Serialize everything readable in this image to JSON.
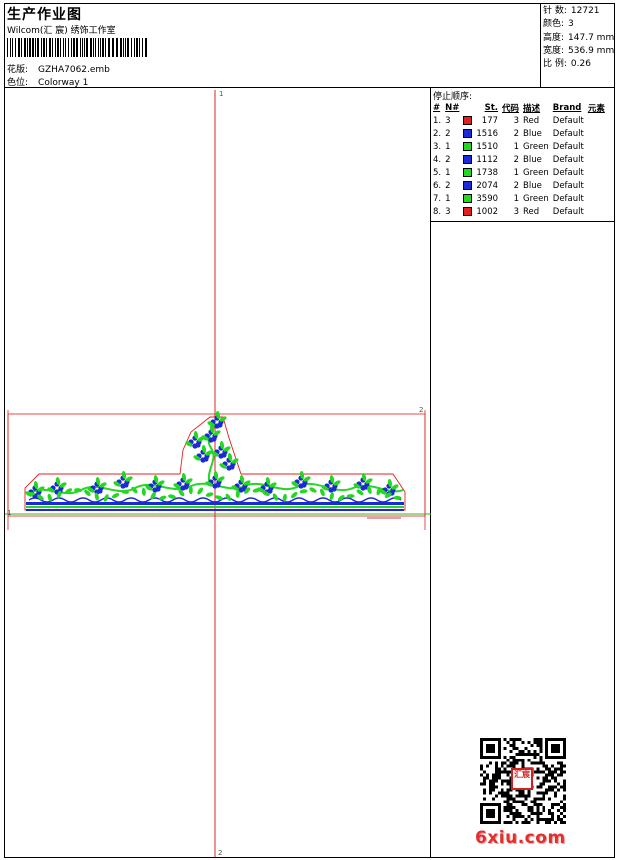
{
  "header": {
    "title": "生产作业图",
    "company": "Wilcom(汇 宸) 绣饰工作室",
    "design_label": "花版:",
    "design_value": "GZHA7062.emb",
    "colorway_label": "色位:",
    "colorway_value": "Colorway 1"
  },
  "stats": {
    "stitches_label": "针 数:",
    "stitches_value": "12721",
    "colors_label": "颜色:",
    "colors_value": "3",
    "height_label": "高度:",
    "height_value": "147.7 mm",
    "width_label": "宽度:",
    "width_value": "536.9 mm",
    "scale_label": "比 例:",
    "scale_value": "0.26"
  },
  "stop_sequence": {
    "title": "停止顺序:",
    "headers": [
      "#",
      "N#",
      "St.",
      "代码",
      "描述",
      "Brand",
      "元素"
    ],
    "rows": [
      {
        "idx": "1.",
        "n": "3",
        "color": "#e02020",
        "st": "177",
        "code": "3",
        "desc": "Red",
        "brand": "Default"
      },
      {
        "idx": "2.",
        "n": "2",
        "color": "#1c2ad6",
        "st": "1516",
        "code": "2",
        "desc": "Blue",
        "brand": "Default"
      },
      {
        "idx": "3.",
        "n": "1",
        "color": "#22d822",
        "st": "1510",
        "code": "1",
        "desc": "Green",
        "brand": "Default"
      },
      {
        "idx": "4.",
        "n": "2",
        "color": "#1c2ad6",
        "st": "1112",
        "code": "2",
        "desc": "Blue",
        "brand": "Default"
      },
      {
        "idx": "5.",
        "n": "1",
        "color": "#22d822",
        "st": "1738",
        "code": "1",
        "desc": "Green",
        "brand": "Default"
      },
      {
        "idx": "6.",
        "n": "2",
        "color": "#1c2ad6",
        "st": "2074",
        "code": "2",
        "desc": "Blue",
        "brand": "Default"
      },
      {
        "idx": "7.",
        "n": "1",
        "color": "#22d822",
        "st": "3590",
        "code": "1",
        "desc": "Green",
        "brand": "Default"
      },
      {
        "idx": "8.",
        "n": "3",
        "color": "#e02020",
        "st": "1002",
        "code": "3",
        "desc": "Red",
        "brand": "Default"
      }
    ]
  },
  "canvas": {
    "axis_top": "1",
    "axis_bottom": "2",
    "axis_right": "2",
    "axis_left": "1",
    "axis_color": "#e02020"
  },
  "watermark": {
    "brand": "6xiu.com",
    "seal_text": "汇宸"
  }
}
